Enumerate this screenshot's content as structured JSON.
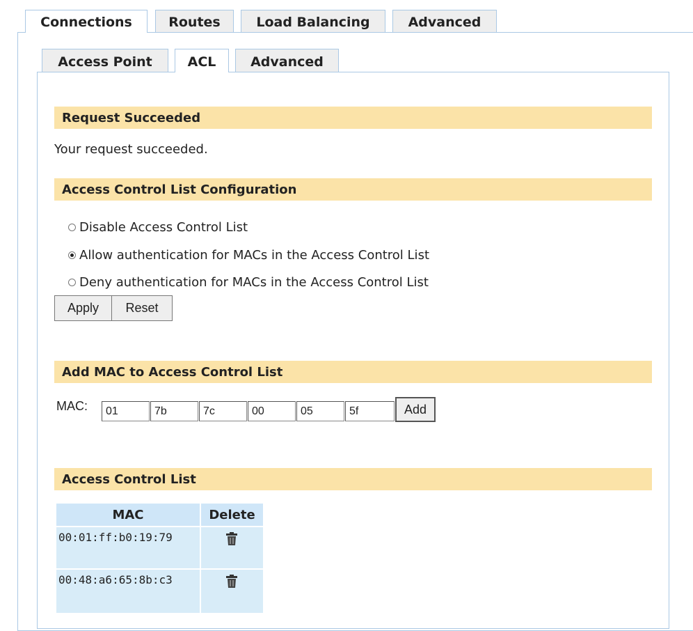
{
  "top_tabs": [
    "Connections",
    "Routes",
    "Load Balancing",
    "Advanced"
  ],
  "sub_tabs": [
    "Access Point",
    "ACL",
    "Advanced"
  ],
  "sections": {
    "request_title": "Request Succeeded",
    "request_message": "Your request succeeded.",
    "acl_config_title": "Access Control List Configuration",
    "add_mac_title": "Add MAC to Access Control List",
    "acl_list_title": "Access Control List"
  },
  "radio_options": [
    {
      "label": "Disable Access Control List",
      "checked": false
    },
    {
      "label": "Allow authentication for MACs in the Access Control List",
      "checked": true
    },
    {
      "label": "Deny authentication for MACs in the Access Control List",
      "checked": false
    }
  ],
  "buttons": {
    "apply": "Apply",
    "reset": "Reset",
    "add": "Add"
  },
  "mac_form": {
    "label": "MAC:",
    "octets": [
      "01",
      "7b",
      "7c",
      "00",
      "05",
      "5f"
    ]
  },
  "acl_table": {
    "headers": [
      "MAC",
      "Delete"
    ],
    "rows": [
      {
        "mac": "00:01:ff:b0:19:79",
        "delete_icon": "trash-icon"
      },
      {
        "mac": "00:48:a6:65:8b:c3",
        "delete_icon": "trash-icon"
      }
    ]
  },
  "colors": {
    "section_bar": "#fbe3a8",
    "tab_border": "#aac8e4",
    "table_cell": "#d8ecf8"
  }
}
